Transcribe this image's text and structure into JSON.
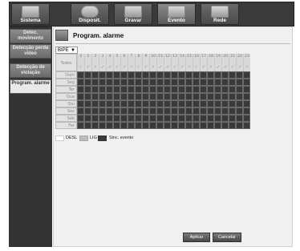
{
  "tabs": [
    {
      "label": "Sistema"
    },
    {
      "label": "Disposit."
    },
    {
      "label": "Gravar"
    },
    {
      "label": "Evento"
    },
    {
      "label": "Rede"
    }
  ],
  "active_tab": "Evento",
  "sidebar": {
    "items": [
      {
        "label": "Detec. movimento"
      },
      {
        "label": "Detecção perda vídeo"
      },
      {
        "label": "Detecção de violação"
      },
      {
        "label": "Program. alarme"
      }
    ],
    "active_item": "Program. alarme"
  },
  "panel": {
    "title": "Program. alarme",
    "select_value": "BIPE"
  },
  "schedule": {
    "corner_label": "Todos",
    "hours": [
      "0",
      "1",
      "2",
      "3",
      "4",
      "5",
      "6",
      "7",
      "8",
      "9",
      "10",
      "11",
      "12",
      "13",
      "14",
      "15",
      "16",
      "17",
      "18",
      "19",
      "20",
      "21",
      "22",
      "23"
    ],
    "days": [
      "Dom",
      "Seg",
      "Ter",
      "Qua",
      "Qui",
      "Sex",
      "Sáb",
      "Fer"
    ]
  },
  "legend": {
    "off": "DESL",
    "on": "LIG",
    "sync": "Sinc. evento"
  },
  "colors": {
    "off": "#ffffff",
    "on": "#bdbdbd",
    "sync": "#3a3a3a"
  },
  "buttons": {
    "apply": "Aplicar",
    "cancel": "Cancelar"
  }
}
